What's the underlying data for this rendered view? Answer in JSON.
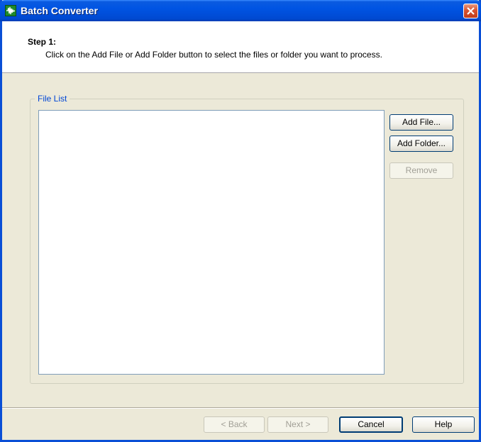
{
  "window": {
    "title": "Batch Converter",
    "icon": "waveform-app-icon",
    "close": "close-icon"
  },
  "header": {
    "step_title": "Step 1:",
    "step_desc": "Click on the Add File or Add Folder button to select the files or folder you want to process."
  },
  "file_list": {
    "label": "File List",
    "items": []
  },
  "side_buttons": {
    "add_file": "Add File...",
    "add_folder": "Add Folder...",
    "remove": "Remove"
  },
  "footer": {
    "back": "< Back",
    "next": "Next >",
    "cancel": "Cancel",
    "help": "Help"
  },
  "colors": {
    "title_bar": "#0054e3",
    "dialog_bg": "#ece9d8",
    "close_red": "#d8522f",
    "group_label": "#0046d5"
  }
}
